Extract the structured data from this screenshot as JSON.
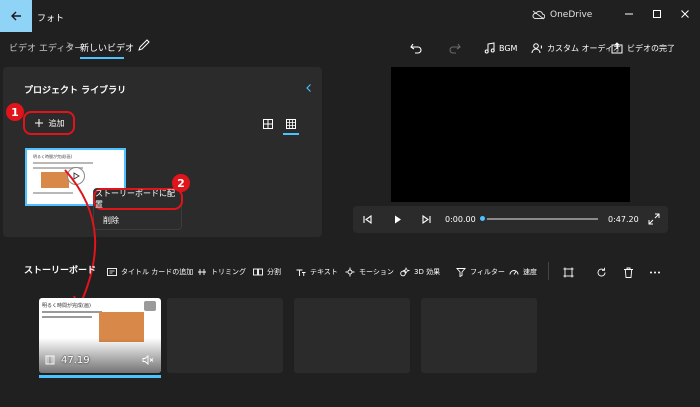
{
  "titlebar": {
    "app_title": "フォト",
    "onedrive_label": "OneDrive"
  },
  "toolbar": {
    "breadcrumb_parent": "ビデオ エディター",
    "breadcrumb_separator": ">",
    "breadcrumb_current": "新しいビデオ",
    "bgm_label": "BGM",
    "custom_audio_label": "カスタム オーディオ",
    "finish_video_label": "ビデオの完了"
  },
  "library": {
    "title": "プロジェクト ライブラリ",
    "add_label": "追加",
    "thumb_title": "明るく時間が完成(画)"
  },
  "context_menu": {
    "items": [
      "ストーリーボードに配置",
      "削除"
    ]
  },
  "annotations": {
    "badge1": "1",
    "badge2": "2",
    "accent_color": "#e0141b"
  },
  "player": {
    "current_time": "0:00.00",
    "total_time": "0:47.20",
    "progress_fraction": 0.0
  },
  "storyboard": {
    "title": "ストーリーボード",
    "tools": [
      {
        "label": "タイトル カードの追加",
        "icon": "title-card-icon"
      },
      {
        "label": "トリミング",
        "icon": "trim-icon"
      },
      {
        "label": "分割",
        "icon": "split-icon"
      },
      {
        "label": "テキスト",
        "icon": "text-icon"
      },
      {
        "label": "モーション",
        "icon": "motion-icon"
      },
      {
        "label": "3D 効果",
        "icon": "effects-3d-icon"
      },
      {
        "label": "フィルター",
        "icon": "filter-icon"
      },
      {
        "label": "速度",
        "icon": "speed-icon"
      }
    ],
    "clip_duration": "47.19",
    "clip_title": "明るく時間が完成(画)"
  },
  "colors": {
    "accent": "#4cc2ff",
    "annotation_red": "#e0141b",
    "background": "#202020",
    "panel": "#2b2b2b"
  }
}
